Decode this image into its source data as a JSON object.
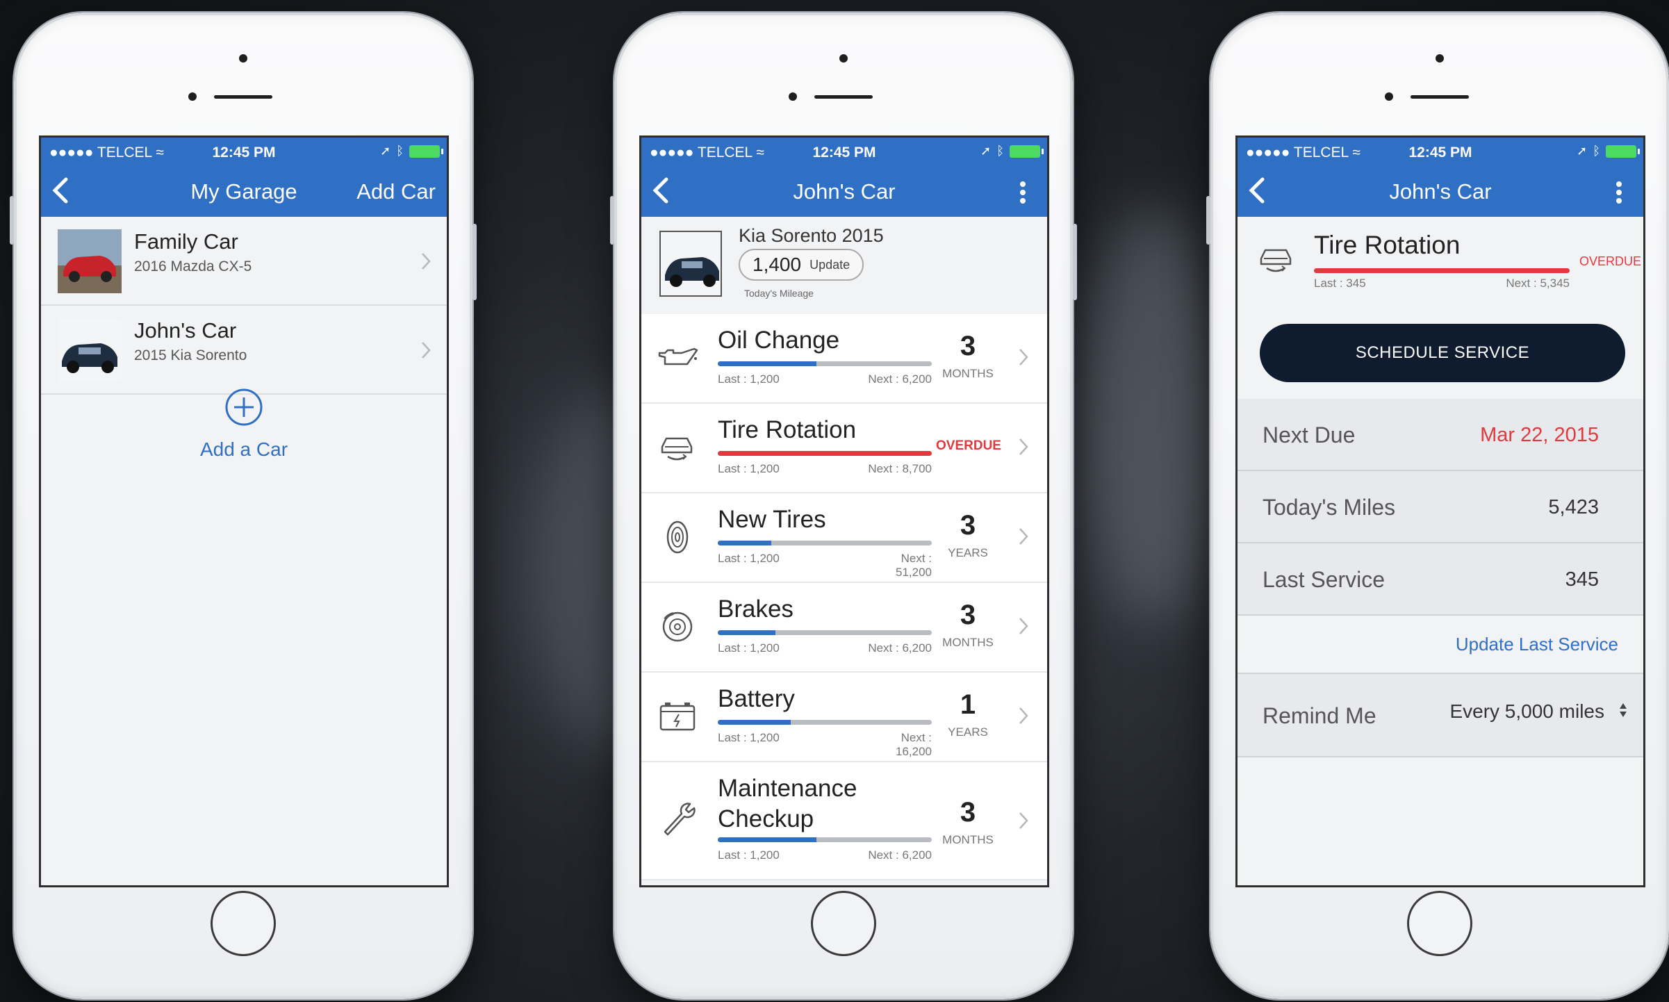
{
  "status_bar": {
    "carrier": "●●●●● TELCEL",
    "time": "12:45 PM"
  },
  "screen1": {
    "title": "My Garage",
    "right_action": "Add Car",
    "cars": [
      {
        "name": "Family Car",
        "model": "2016 Mazda CX-5",
        "color": "#c8232b"
      },
      {
        "name": "John's Car",
        "model": "2015 Kia Sorento",
        "color": "#1e2d3f"
      }
    ],
    "add_label": "Add a Car"
  },
  "screen2": {
    "title": "John's Car",
    "car_model": "Kia Sorento 2015",
    "mileage": "1,400",
    "update_label": "Update",
    "mileage_caption": "Today's Mileage",
    "services": [
      {
        "name": "Oil Change",
        "icon": "oil-can-icon",
        "last": "Last : 1,200",
        "next": "Next : 6,200",
        "count": "3",
        "unit": "MONTHS",
        "progress": 0.46,
        "overdue": false
      },
      {
        "name": "Tire Rotation",
        "icon": "car-lift-icon",
        "last": "Last : 1,200",
        "next": "Next : 8,700",
        "count": "",
        "unit": "",
        "status": "OVERDUE",
        "progress": 1.0,
        "overdue": true
      },
      {
        "name": "New Tires",
        "icon": "tire-icon",
        "last": "Last : 1,200",
        "next": "Next : 51,200",
        "count": "3",
        "unit": "YEARS",
        "progress": 0.25,
        "overdue": false
      },
      {
        "name": "Brakes",
        "icon": "brake-disc-icon",
        "last": "Last : 1,200",
        "next": "Next : 6,200",
        "count": "3",
        "unit": "MONTHS",
        "progress": 0.27,
        "overdue": false
      },
      {
        "name": "Battery",
        "icon": "battery-icon",
        "last": "Last : 1,200",
        "next": "Next : 16,200",
        "count": "1",
        "unit": "YEARS",
        "progress": 0.34,
        "overdue": false
      },
      {
        "name": "Maintenance Checkup",
        "icon": "wrench-icon",
        "last": "Last : 1,200",
        "next": "Next : 6,200",
        "count": "3",
        "unit": "MONTHS",
        "progress": 0.46,
        "overdue": false
      }
    ]
  },
  "screen3": {
    "title": "John's Car",
    "service_title": "Tire Rotation",
    "last": "Last : 345",
    "next": "Next : 5,345",
    "status": "OVERDUE",
    "progress": 1.0,
    "schedule_label": "SCHEDULE SERVICE",
    "rows": [
      {
        "key": "Next Due",
        "value": "Mar 22, 2015"
      },
      {
        "key": "Today's Miles",
        "value": "5,423"
      },
      {
        "key": "Last Service",
        "value": "345"
      }
    ],
    "update_link": "Update Last Service",
    "remind_label": "Remind Me",
    "remind_value": "Every 5,000 miles"
  },
  "colors": {
    "brand_blue": "#2f6fc4",
    "overdue_red": "#e0393e",
    "button_navy": "#0f1b2e"
  }
}
